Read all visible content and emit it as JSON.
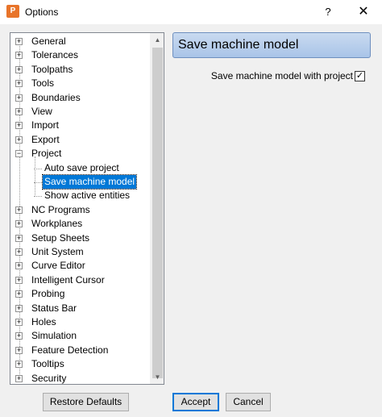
{
  "window": {
    "title": "Options",
    "help_label": "?",
    "close_label": "✕",
    "app_icon_glyph": "P"
  },
  "tree": {
    "expander_plus": "+",
    "expander_minus": "−",
    "items": [
      {
        "label": "General",
        "expanded": false
      },
      {
        "label": "Tolerances",
        "expanded": false
      },
      {
        "label": "Toolpaths",
        "expanded": false
      },
      {
        "label": "Tools",
        "expanded": false
      },
      {
        "label": "Boundaries",
        "expanded": false
      },
      {
        "label": "View",
        "expanded": false
      },
      {
        "label": "Import",
        "expanded": false
      },
      {
        "label": "Export",
        "expanded": false
      },
      {
        "label": "Project",
        "expanded": true
      },
      {
        "label": "NC Programs",
        "expanded": false
      },
      {
        "label": "Workplanes",
        "expanded": false
      },
      {
        "label": "Setup Sheets",
        "expanded": false
      },
      {
        "label": "Unit System",
        "expanded": false
      },
      {
        "label": "Curve Editor",
        "expanded": false
      },
      {
        "label": "Intelligent Cursor",
        "expanded": false
      },
      {
        "label": "Probing",
        "expanded": false
      },
      {
        "label": "Status Bar",
        "expanded": false
      },
      {
        "label": "Holes",
        "expanded": false
      },
      {
        "label": "Simulation",
        "expanded": false
      },
      {
        "label": "Feature Detection",
        "expanded": false
      },
      {
        "label": "Tooltips",
        "expanded": false
      },
      {
        "label": "Security",
        "expanded": false
      }
    ],
    "project_children": [
      {
        "label": "Auto save project",
        "selected": false
      },
      {
        "label": "Save machine model",
        "selected": true
      },
      {
        "label": "Show active entities",
        "selected": false
      }
    ]
  },
  "panel": {
    "header": "Save machine model",
    "option_label": "Save machine model with project",
    "option_checked": true,
    "check_glyph": "✓"
  },
  "buttons": {
    "restore": "Restore Defaults",
    "accept": "Accept",
    "cancel": "Cancel"
  },
  "scrollbar": {
    "up_glyph": "▲",
    "down_glyph": "▼"
  }
}
